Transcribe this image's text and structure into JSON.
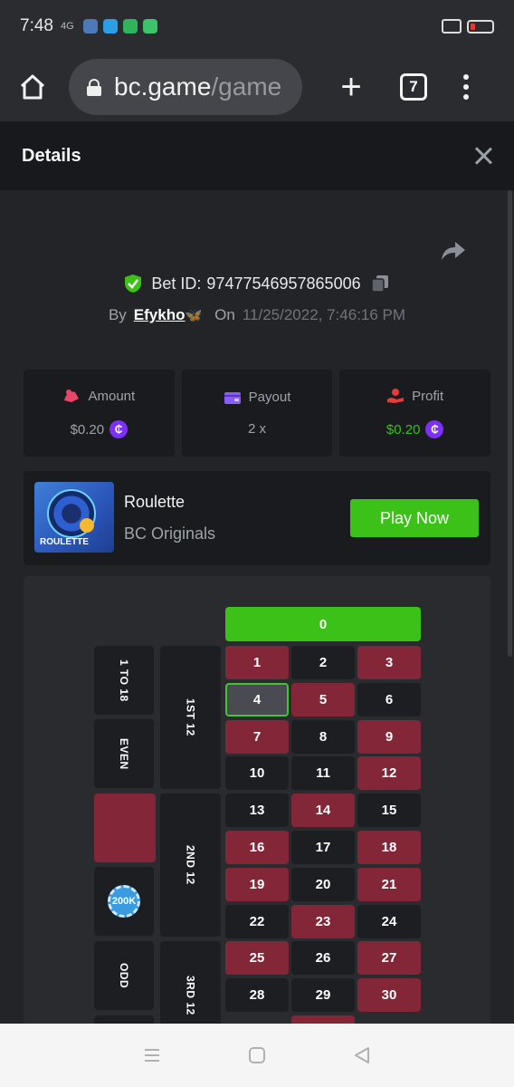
{
  "status": {
    "time": "7:48",
    "signal": "4G"
  },
  "browser": {
    "url_host": "bc.game",
    "url_path": "/game",
    "tab_count": "7"
  },
  "header": {
    "title": "Details"
  },
  "bet": {
    "id_label": "Bet ID:",
    "id": "97477546957865006",
    "by_label": "By",
    "user": "Efykho",
    "on_label": "On",
    "date": "11/25/2022, 7:46:16 PM"
  },
  "stats": {
    "amount_label": "Amount",
    "amount_value": "$0.20",
    "payout_label": "Payout",
    "payout_value": "2 x",
    "profit_label": "Profit",
    "profit_value": "$0.20"
  },
  "game": {
    "name": "Roulette",
    "provider": "BC Originals",
    "thumb_label": "ROULETTE",
    "play_label": "Play Now"
  },
  "board": {
    "zero": "0",
    "outside_1": "1 TO 18",
    "outside_2": "EVEN",
    "outside_3": "ODD",
    "dozen_1": "1ST 12",
    "dozen_2": "2ND 12",
    "dozen_3": "3RD 12",
    "chip_label": "200K",
    "numbers": [
      "1",
      "2",
      "3",
      "4",
      "5",
      "6",
      "7",
      "8",
      "9",
      "10",
      "11",
      "12",
      "13",
      "14",
      "15",
      "16",
      "17",
      "18",
      "19",
      "20",
      "21",
      "22",
      "23",
      "24",
      "25",
      "26",
      "27",
      "28",
      "29",
      "30"
    ],
    "selected": "4"
  },
  "colors": {
    "red": "#832637",
    "black": "#1d1e21",
    "green": "#3bc117",
    "accent_purple": "#7b2ff7"
  }
}
